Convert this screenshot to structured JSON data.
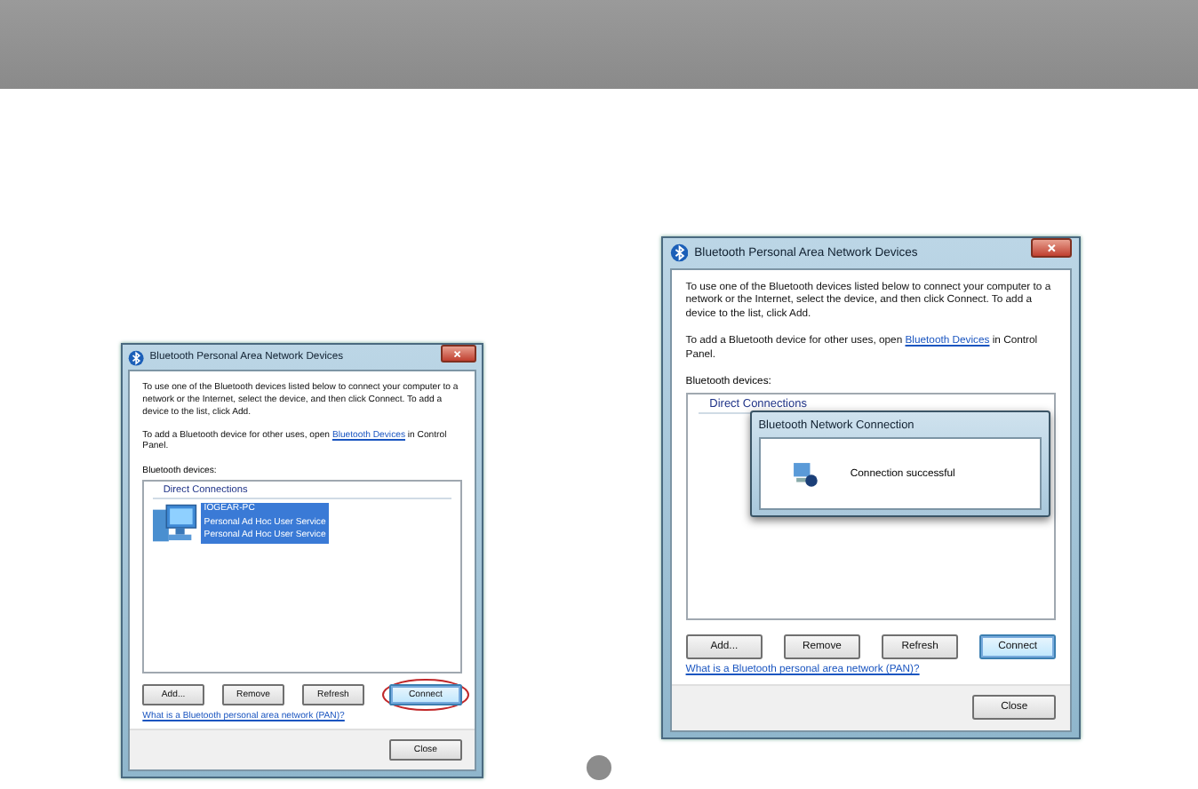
{
  "screenshots": [
    {
      "title": "Bluetooth Personal Area Network Devices",
      "intro": "To use one of the Bluetooth devices listed below to connect your computer to a network or the Internet, select the device, and then click Connect. To add a device to the list, click Add.",
      "note_before": "To add a Bluetooth device for other uses, open ",
      "note_link": "Bluetooth Devices",
      "note_after": " in Control Panel.",
      "list_label": "Bluetooth devices:",
      "group": "Direct Connections",
      "device": {
        "name": "IOGEAR-PC",
        "services": [
          "Personal Ad Hoc User Service",
          "Personal Ad Hoc User Service"
        ],
        "selected": true
      },
      "buttons": [
        {
          "label": "Add...",
          "default": false,
          "highlighted": false
        },
        {
          "label": "Remove",
          "default": false,
          "highlighted": false
        },
        {
          "label": "Refresh",
          "default": false,
          "highlighted": false
        },
        {
          "label": "Connect",
          "default": true,
          "highlighted": true
        }
      ],
      "help_link": "What is a Bluetooth personal area network (PAN)?",
      "close": "Close"
    },
    {
      "title": "Bluetooth Personal Area Network Devices",
      "intro": "To use one of the Bluetooth devices listed below to connect your computer to a network or the Internet, select the device, and then click Connect. To add a device to the list, click Add.",
      "note_before": "To add a Bluetooth device for other uses, open ",
      "note_link": "Bluetooth Devices",
      "note_after": " in Control Panel.",
      "list_label": "Bluetooth devices:",
      "group": "Direct Connections",
      "buttons": [
        {
          "label": "Add...",
          "default": false,
          "highlighted": false
        },
        {
          "label": "Remove",
          "default": false,
          "highlighted": false
        },
        {
          "label": "Refresh",
          "default": false,
          "highlighted": false
        },
        {
          "label": "Connect",
          "default": true,
          "highlighted": false
        }
      ],
      "help_link": "What is a Bluetooth personal area network (PAN)?",
      "close": "Close",
      "popup": {
        "title": "Bluetooth Network Connection",
        "message": "Connection successful"
      }
    }
  ]
}
